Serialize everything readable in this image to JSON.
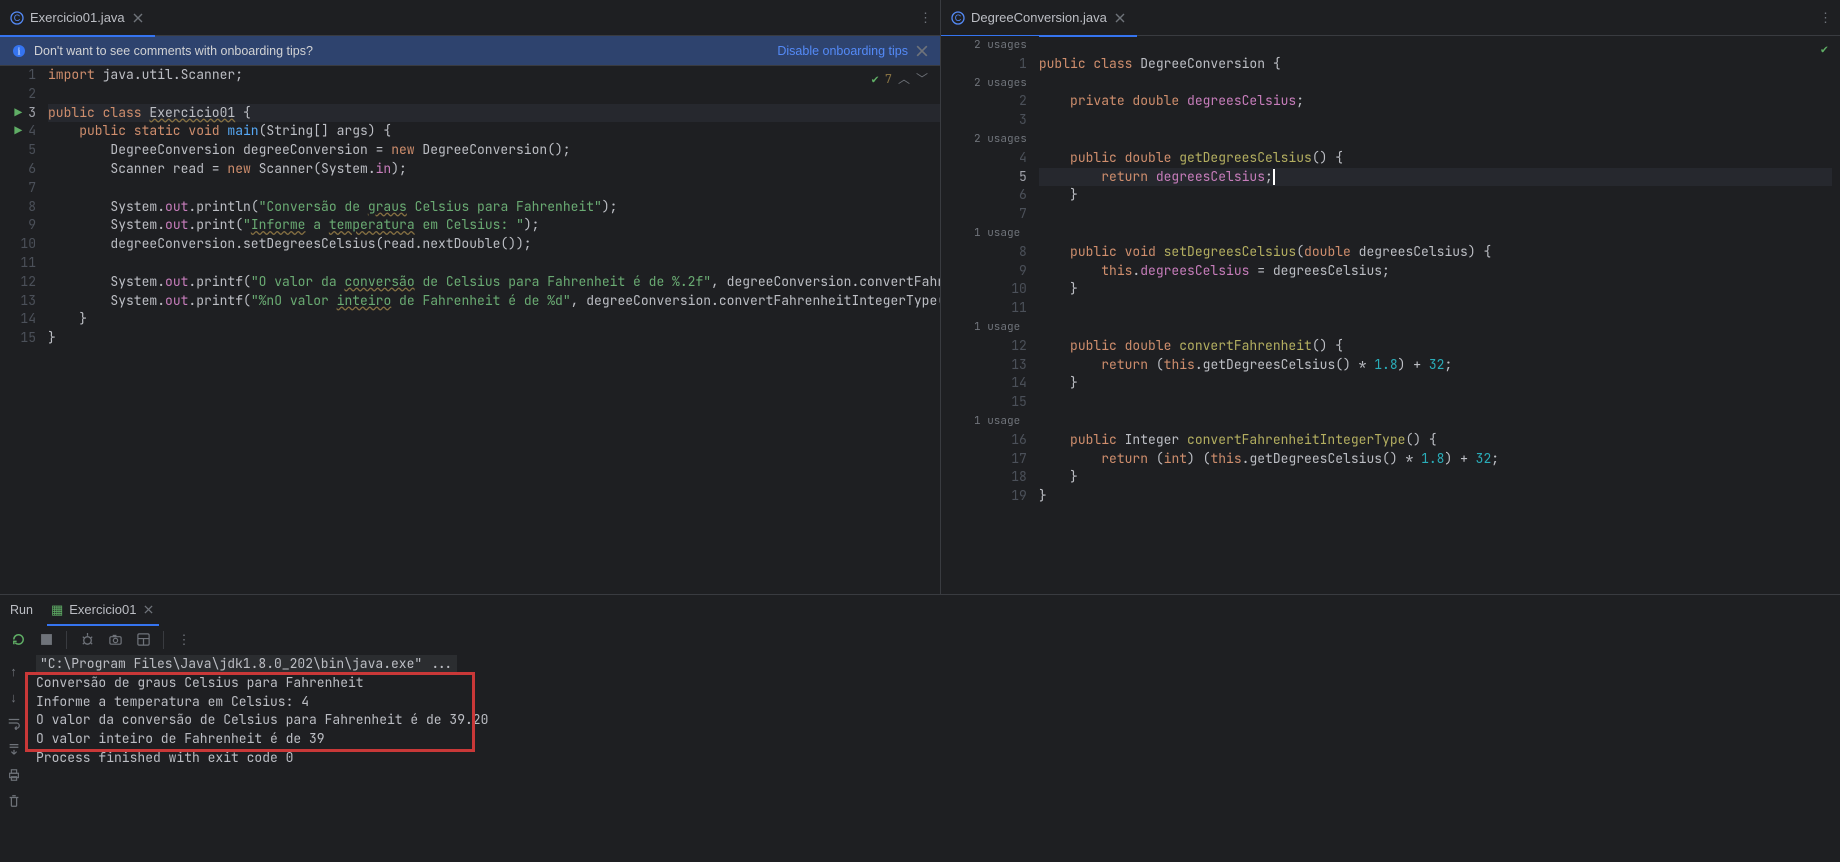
{
  "tabs_left": {
    "name": "Exercicio01.java"
  },
  "tabs_right": {
    "name": "DegreeConversion.java"
  },
  "banner": {
    "text": "Don't want to see comments with onboarding tips?",
    "link": "Disable onboarding tips"
  },
  "inspection_left": {
    "count": "7"
  },
  "code_left": {
    "l1a": "import",
    "l1b": " java.util.Scanner;",
    "l3a": "public class ",
    "l3b": "Exercicio01",
    "l3c": " {",
    "l4a": "    ",
    "l4b": "public static void ",
    "l4c": "main",
    "l4d": "(String[] args) {",
    "l5a": "        DegreeConversion degreeConversion = ",
    "l5b": "new",
    "l5c": " DegreeConversion();",
    "l6a": "        Scanner read = ",
    "l6b": "new",
    "l6c": " Scanner(System.",
    "l6d": "in",
    "l6e": ");",
    "l8a": "        System.",
    "l8b": "out",
    "l8c": ".println(",
    "l8d": "\"Conversão de ",
    "l8e": "graus",
    "l8f": " Celsius para Fahrenheit\"",
    "l8g": ");",
    "l9a": "        System.",
    "l9b": "out",
    "l9c": ".print(",
    "l9d": "\"",
    "l9e": "Informe",
    "l9f": " a ",
    "l9g": "temperatura",
    "l9h": " em Celsius: \"",
    "l9i": ");",
    "l10a": "        degreeConversion.setDegreesCelsius(read.nextDouble());",
    "l12a": "        System.",
    "l12b": "out",
    "l12c": ".printf(",
    "l12d": "\"O valor da ",
    "l12e": "conversão",
    "l12f": " de Celsius para Fahrenheit é de %.2f\"",
    "l12g": ", degreeConversion.convertFahrenheit());",
    "l13a": "        System.",
    "l13b": "out",
    "l13c": ".printf(",
    "l13d": "\"%nO valor ",
    "l13e": "inteiro",
    "l13f": " de Fahrenheit é de %d\"",
    "l13g": ", degreeConversion.convertFahrenheitIntegerType());",
    "l14": "    }",
    "l15": "}"
  },
  "usages": {
    "u2a": "2 usages",
    "u2b": "2 usages",
    "u2c": "2 usages",
    "u1a": "1 usage",
    "u1b": "1 usage",
    "u1c": "1 usage"
  },
  "code_right": {
    "l1a": "public class ",
    "l1b": "DegreeConversion {",
    "l2a": "    ",
    "l2b": "private double ",
    "l2c": "degreesCelsius",
    ";": ";",
    "l4a": "    ",
    "l4b": "public double ",
    "l4c": "getDegreesCelsius",
    "l4d": "() {",
    "l5a": "        ",
    "l5b": "return ",
    "l5c": "degreesCelsius",
    "l5d": ";",
    "l6": "    }",
    "l8a": "    ",
    "l8b": "public void ",
    "l8c": "setDegreesCelsius",
    "l8d": "(",
    "l8e": "double",
    "l8f": " degreesCelsius) {",
    "l9a": "        ",
    "l9b": "this",
    "l9c": ".",
    "l9d": "degreesCelsius",
    "l9e": " = degreesCelsius;",
    "l10": "    }",
    "l12a": "    ",
    "l12b": "public double ",
    "l12c": "convertFahrenheit",
    "l12d": "() {",
    "l13a": "        ",
    "l13b": "return",
    "l13c": " (",
    "l13d": "this",
    "l13e": ".getDegreesCelsius() * ",
    "l13f": "1.8",
    "l13g": ") + ",
    "l13h": "32",
    "l13i": ";",
    "l14": "    }",
    "l16a": "    ",
    "l16b": "public ",
    "l16c": "Integer ",
    "l16d": "convertFahrenheitIntegerType",
    "l16e": "() {",
    "l17a": "        ",
    "l17b": "return",
    "l17c": " (",
    "l17d": "int",
    "l17e": ") (",
    "l17f": "this",
    "l17g": ".getDegreesCelsius() * ",
    "l17h": "1.8",
    "l17i": ") + ",
    "l17j": "32",
    "l17k": ";",
    "l18": "    }",
    "l19": "}"
  },
  "ln_left": [
    "1",
    "2",
    "3",
    "4",
    "5",
    "6",
    "7",
    "8",
    "9",
    "10",
    "11",
    "12",
    "13",
    "14",
    "15"
  ],
  "ln_right": [
    "1",
    "2",
    "3",
    "4",
    "5",
    "6",
    "7",
    "8",
    "9",
    "10",
    "11",
    "12",
    "13",
    "14",
    "15",
    "16",
    "17",
    "18",
    "19"
  ],
  "run": {
    "title": "Run",
    "tab": "Exercicio01",
    "cmd": "\"C:\\Program Files\\Java\\jdk1.8.0_202\\bin\\java.exe\" ...",
    "o1": "Conversão de graus Celsius para Fahrenheit",
    "o2": "Informe a temperatura em Celsius: 4",
    "o3": "O valor da conversão de Celsius para Fahrenheit é de 39.20",
    "o4": "O valor inteiro de Fahrenheit é de 39",
    "o5": "Process finished with exit code 0"
  }
}
